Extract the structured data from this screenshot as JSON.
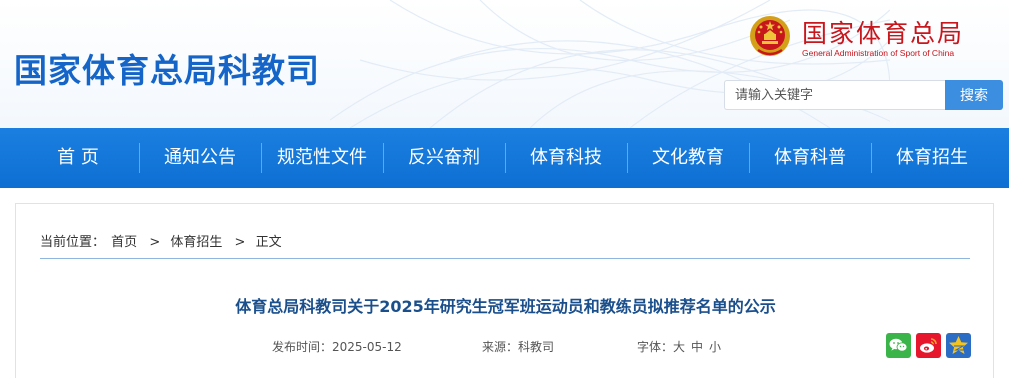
{
  "header": {
    "site_title": "国家体育总局科教司",
    "org_name_cn": "国家体育总局",
    "org_name_en": "General Administration of Sport of China",
    "search": {
      "placeholder": "请输入关键字",
      "button_label": "搜索"
    }
  },
  "nav": {
    "items": [
      {
        "label": "首 页"
      },
      {
        "label": "通知公告"
      },
      {
        "label": "规范性文件"
      },
      {
        "label": "反兴奋剂"
      },
      {
        "label": "体育科技"
      },
      {
        "label": "文化教育"
      },
      {
        "label": "体育科普"
      },
      {
        "label": "体育招生"
      }
    ]
  },
  "breadcrumb": {
    "prefix": "当前位置：",
    "items": [
      {
        "label": "首页"
      },
      {
        "label": "体育招生"
      },
      {
        "label": "正文"
      }
    ],
    "separator": ">"
  },
  "article": {
    "title": "体育总局科教司关于2025年研究生冠军班运动员和教练员拟推荐名单的公示",
    "date_label": "发布时间：",
    "date": "2025-05-12",
    "source_label": "来源：",
    "source": "科教司",
    "font_label": "字体：",
    "font_sizes": [
      "大",
      "中",
      "小"
    ]
  },
  "share": {
    "icons": [
      "wechat-icon",
      "weibo-icon",
      "qzone-icon"
    ]
  },
  "colors": {
    "brand_blue": "#1565c8",
    "nav_blue": "#0e6fd3",
    "org_red": "#c8161d",
    "title_blue": "#1a4f8c",
    "wechat_green": "#3bb449",
    "weibo_red": "#e6162d",
    "qzone_blue": "#2b6cc4"
  }
}
